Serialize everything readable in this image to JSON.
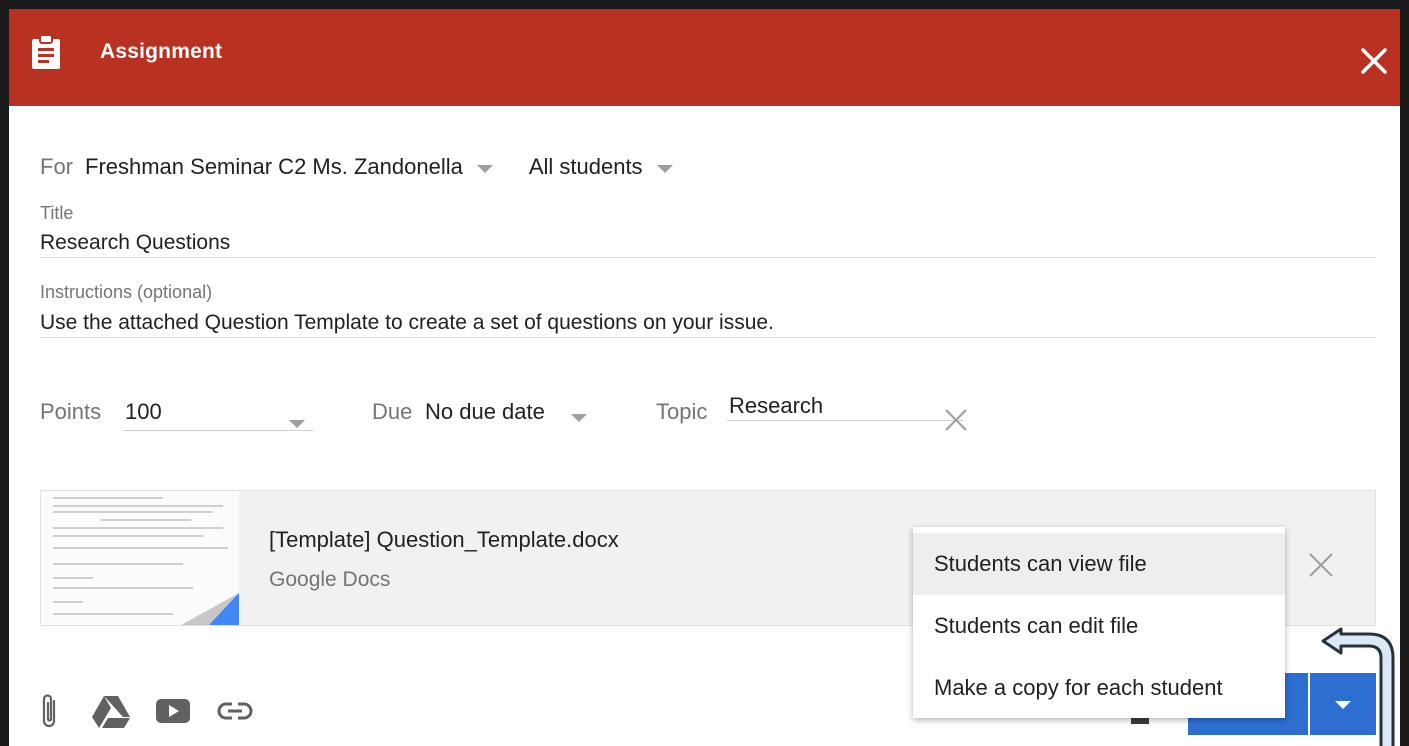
{
  "header": {
    "title": "Assignment",
    "background": "#b93221"
  },
  "for_row": {
    "label": "For",
    "class_name": "Freshman Seminar C2 Ms. Zandonella",
    "audience": "All students"
  },
  "title_field": {
    "label": "Title",
    "value": "Research Questions"
  },
  "instructions_field": {
    "label": "Instructions (optional)",
    "value": "Use the attached Question Template to create a set of questions on your issue."
  },
  "points": {
    "label": "Points",
    "value": "100"
  },
  "due": {
    "label": "Due",
    "value": "No due date"
  },
  "topic": {
    "label": "Topic",
    "value": "Research"
  },
  "attachment": {
    "file_name": "[Template] Question_Template.docx",
    "file_type": "Google Docs"
  },
  "share_menu": {
    "items": [
      {
        "label": "Students can view file"
      },
      {
        "label": "Students can edit file"
      },
      {
        "label": "Make a copy for each student"
      }
    ],
    "selected_index": 0
  },
  "toolbar": {
    "icons": [
      "paperclip-icon",
      "google-drive-icon",
      "youtube-icon",
      "link-icon"
    ]
  },
  "colors": {
    "accent_red": "#b93221",
    "primary_blue": "#2c6fd1",
    "arrow_blue": "#c6dcef"
  }
}
